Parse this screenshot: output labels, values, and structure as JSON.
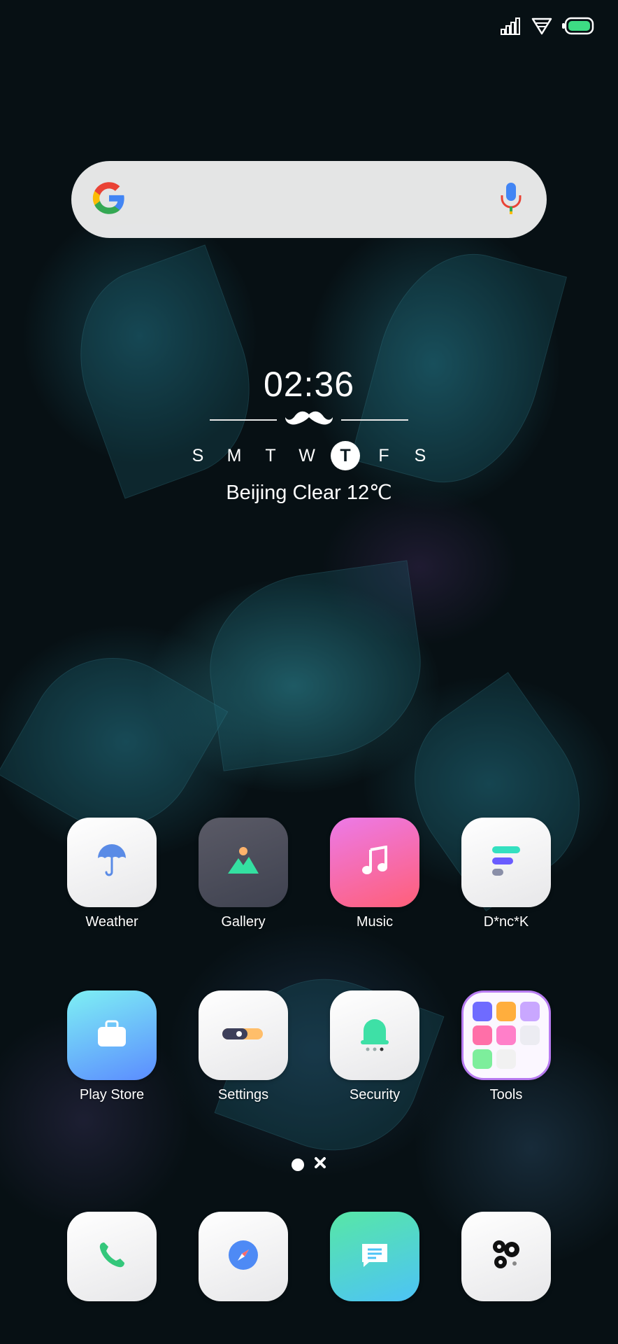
{
  "status_bar": {
    "signal_icon": "signal-icon",
    "wifi_icon": "wifi-icon",
    "battery_icon": "battery-icon"
  },
  "search": {
    "logo": "google-logo",
    "mic_icon": "mic-icon"
  },
  "clock": {
    "time": "02:36",
    "days": [
      "S",
      "M",
      "T",
      "W",
      "T",
      "F",
      "S"
    ],
    "active_day_index": 4,
    "weather": "Beijing Clear 12℃"
  },
  "apps": {
    "row1": [
      {
        "label": "Weather"
      },
      {
        "label": "Gallery"
      },
      {
        "label": "Music"
      },
      {
        "label": "D*nc*K"
      }
    ],
    "row2": [
      {
        "label": "Play Store"
      },
      {
        "label": "Settings"
      },
      {
        "label": "Security"
      },
      {
        "label": "Tools"
      }
    ]
  },
  "dock": [
    "phone-icon",
    "browser-compass-icon",
    "messages-icon",
    "camera-icon"
  ],
  "colors": {
    "accent_green": "#34d399",
    "tools_border": "#b77bf0"
  }
}
